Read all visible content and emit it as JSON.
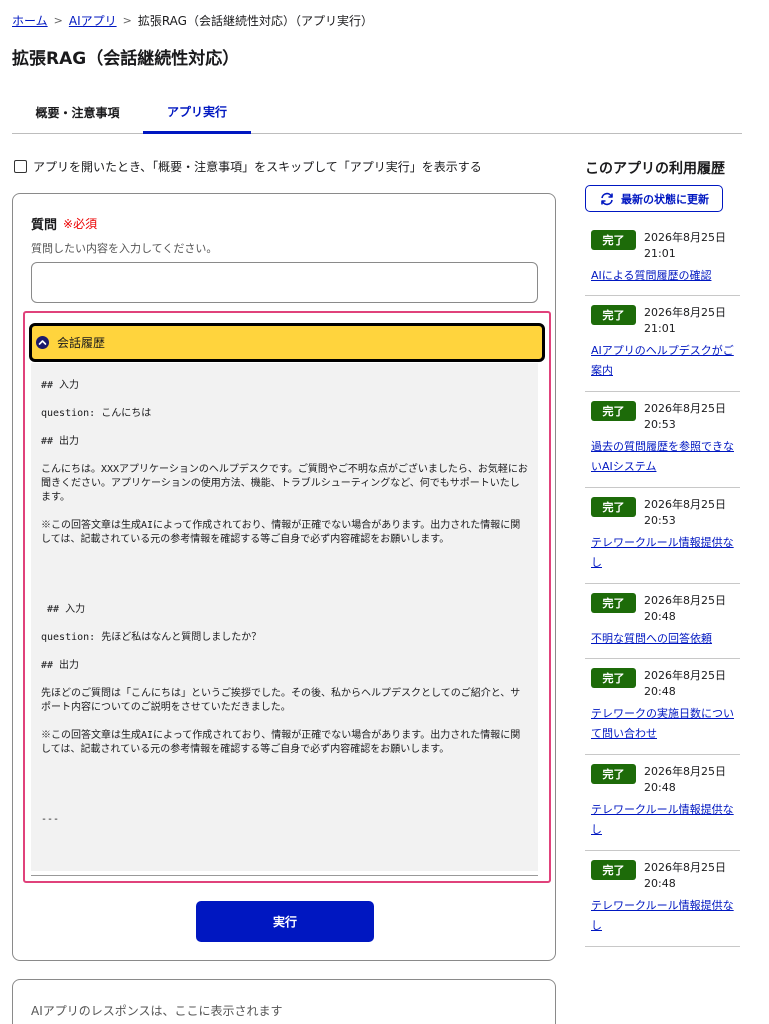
{
  "breadcrumb": {
    "home": "ホーム",
    "ai_apps": "AIアプリ",
    "current": "拡張RAG（会話継続性対応）（アプリ実行）"
  },
  "page_title": "拡張RAG（会話継続性対応）",
  "tabs": [
    {
      "label": "概要・注意事項"
    },
    {
      "label": "アプリ実行"
    }
  ],
  "skip_option": {
    "label": "アプリを開いたとき、「概要・注意事項」をスキップして「アプリ実行」を表示する"
  },
  "form": {
    "question_label": "質問",
    "required_label": "※必須",
    "hint": "質問したい内容を入力してください。",
    "input_value": "",
    "history_header": "会話履歴",
    "history_text": "## 入力\n\nquestion: こんにちは\n\n## 出力\n\nこんにちは。XXXアプリケーションのヘルプデスクです。ご質問やご不明な点がございましたら、お気軽にお聞きください。アプリケーションの使用方法、機能、トラブルシューティングなど、何でもサポートいたします。\n\n※この回答文章は生成AIによって作成されており、情報が正確でない場合があります。出力された情報に関しては、記載されている元の参考情報を確認する等ご自身で必ず内容確認をお願いします。\n\n\n\n\n ## 入力\n\nquestion: 先ほど私はなんと質問しましたか？\n\n## 出力\n\n先ほどのご質問は「こんにちは」というご挨拶でした。その後、私からヘルプデスクとしてのご紹介と、サポート内容についてのご説明をさせていただきました。\n\n※この回答文章は生成AIによって作成されており、情報が正確でない場合があります。出力された情報に関しては、記載されている元の参考情報を確認する等ご自身で必ず内容確認をお願いします。\n\n\n\n\n---",
    "run_label": "実行"
  },
  "response": {
    "placeholder": "AIアプリのレスポンスは、ここに表示されます"
  },
  "sidebar": {
    "title": "このアプリの利用履歴",
    "refresh_label": "最新の状態に更新",
    "items": [
      {
        "status": "完了",
        "date": "2026年8月25日",
        "time": "21:01",
        "title": "AIによる質問履歴の確認"
      },
      {
        "status": "完了",
        "date": "2026年8月25日",
        "time": "21:01",
        "title": "AIアプリのヘルプデスクがご案内"
      },
      {
        "status": "完了",
        "date": "2026年8月25日",
        "time": "20:53",
        "title": "過去の質問履歴を参照できないAIシステム"
      },
      {
        "status": "完了",
        "date": "2026年8月25日",
        "time": "20:53",
        "title": "テレワークルール情報提供なし"
      },
      {
        "status": "完了",
        "date": "2026年8月25日",
        "time": "20:48",
        "title": "不明な質問への回答依頼"
      },
      {
        "status": "完了",
        "date": "2026年8月25日",
        "time": "20:48",
        "title": "テレワークの実施日数について問い合わせ"
      },
      {
        "status": "完了",
        "date": "2026年8月25日",
        "time": "20:48",
        "title": "テレワークルール情報提供なし"
      },
      {
        "status": "完了",
        "date": "2026年8月25日",
        "time": "20:48",
        "title": "テレワークルール情報提供なし"
      }
    ]
  },
  "colors": {
    "accent": "#0017c1",
    "highlight_border": "#e0427b",
    "accordion_bg": "#ffd43d",
    "status_badge": "#1d6b09",
    "required": "#ec0000"
  }
}
